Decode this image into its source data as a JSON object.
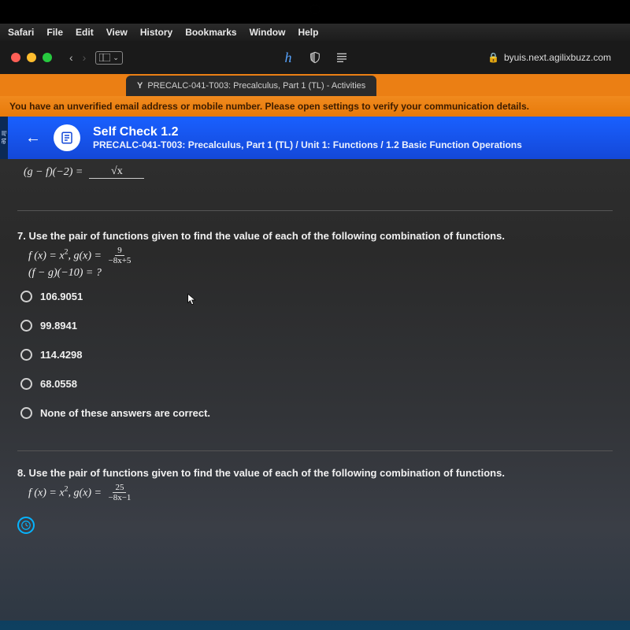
{
  "menubar": [
    "Safari",
    "File",
    "Edit",
    "View",
    "History",
    "Bookmarks",
    "Window",
    "Help"
  ],
  "toolbar": {
    "back": "‹",
    "fwd": "›",
    "sidebar_chevron": "⌄",
    "url_lock": "🔒",
    "url": "byuis.next.agilixbuzz.com"
  },
  "tab": {
    "icon": "Y",
    "title": "PRECALC-041-T003: Precalculus, Part 1 (TL) - Activities"
  },
  "warn": "You have an unverified email address or mobile number. Please open settings to verify your communication details.",
  "left_cut": "lir te",
  "header": {
    "title": "Self Check 1.2",
    "breadcrumb": "PRECALC-041-T003: Precalculus, Part 1 (TL) / Unit 1: Functions / 1.2 Basic Function Operations"
  },
  "prev": {
    "expr": "(g − f)(−2) =",
    "blank_content": "√x"
  },
  "q7": {
    "prompt": "7. Use the pair of functions given to find the value of each of the following combination of functions.",
    "fline_prefix": "f (x) = x",
    "fline_mid": ",  g(x) = ",
    "frac_top": "9",
    "frac_bot": "−8x+5",
    "eval": "(f − g)(−10) = ?",
    "options": [
      "106.9051",
      "99.8941",
      "114.4298",
      "68.0558",
      "None of these answers are correct."
    ]
  },
  "q8": {
    "prompt": "8. Use the pair of functions given to find the value of each of the following combination of functions.",
    "fline_prefix": "f (x) = x",
    "fline_mid": ",  g(x) = ",
    "frac_top": "25",
    "frac_bot": "−8x−1"
  }
}
